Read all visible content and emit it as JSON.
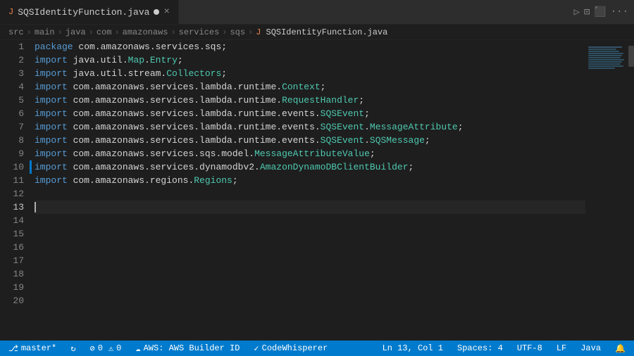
{
  "tab": {
    "filename": "SQSIdentityFunction.java",
    "modified": true,
    "language_icon": "J"
  },
  "breadcrumb": {
    "parts": [
      "src",
      "main",
      "java",
      "com",
      "amazonaws",
      "services",
      "sqs"
    ],
    "file": "SQSIdentityFunction.java",
    "file_icon": "J"
  },
  "lines": [
    {
      "num": 1,
      "code": "package",
      "type": "package_line",
      "content": "package com.amazonaws.services.sqs;"
    },
    {
      "num": 2,
      "content": "import java.util.Map.Entry;"
    },
    {
      "num": 3,
      "content": "import java.util.stream.Collectors;"
    },
    {
      "num": 4,
      "content": "import com.amazonaws.services.lambda.runtime.Context;"
    },
    {
      "num": 5,
      "content": "import com.amazonaws.services.lambda.runtime.RequestHandler;"
    },
    {
      "num": 6,
      "content": "import com.amazonaws.services.lambda.runtime.events.SQSEvent;"
    },
    {
      "num": 7,
      "content": "import com.amazonaws.services.lambda.runtime.events.SQSEvent.MessageAttribute;"
    },
    {
      "num": 8,
      "content": "import com.amazonaws.services.lambda.runtime.events.SQSEvent.SQSMessage;"
    },
    {
      "num": 9,
      "content": "import com.amazonaws.services.sqs.model.MessageAttributeValue;"
    },
    {
      "num": 10,
      "content": "import com.amazonaws.services.dynamodbv2.AmazonDynamoDBClientBuilder;",
      "highlight": true
    },
    {
      "num": 11,
      "content": "import com.amazonaws.regions.Regions;"
    },
    {
      "num": 12,
      "content": ""
    },
    {
      "num": 13,
      "content": "",
      "active": true
    },
    {
      "num": 14,
      "content": ""
    },
    {
      "num": 15,
      "content": ""
    },
    {
      "num": 16,
      "content": ""
    },
    {
      "num": 17,
      "content": ""
    },
    {
      "num": 18,
      "content": ""
    },
    {
      "num": 19,
      "content": ""
    },
    {
      "num": 20,
      "content": ""
    }
  ],
  "status_bar": {
    "branch_icon": "⎇",
    "branch": "master*",
    "sync_icon": "↻",
    "errors": "0",
    "warnings": "0",
    "aws_label": "AWS: AWS Builder ID",
    "codewhisperer": "CodeWhisperer",
    "position": "Ln 13, Col 1",
    "spaces": "Spaces: 4",
    "encoding": "UTF-8",
    "line_ending": "LF",
    "language": "Java",
    "bell_icon": "🔔",
    "notifications": ""
  }
}
